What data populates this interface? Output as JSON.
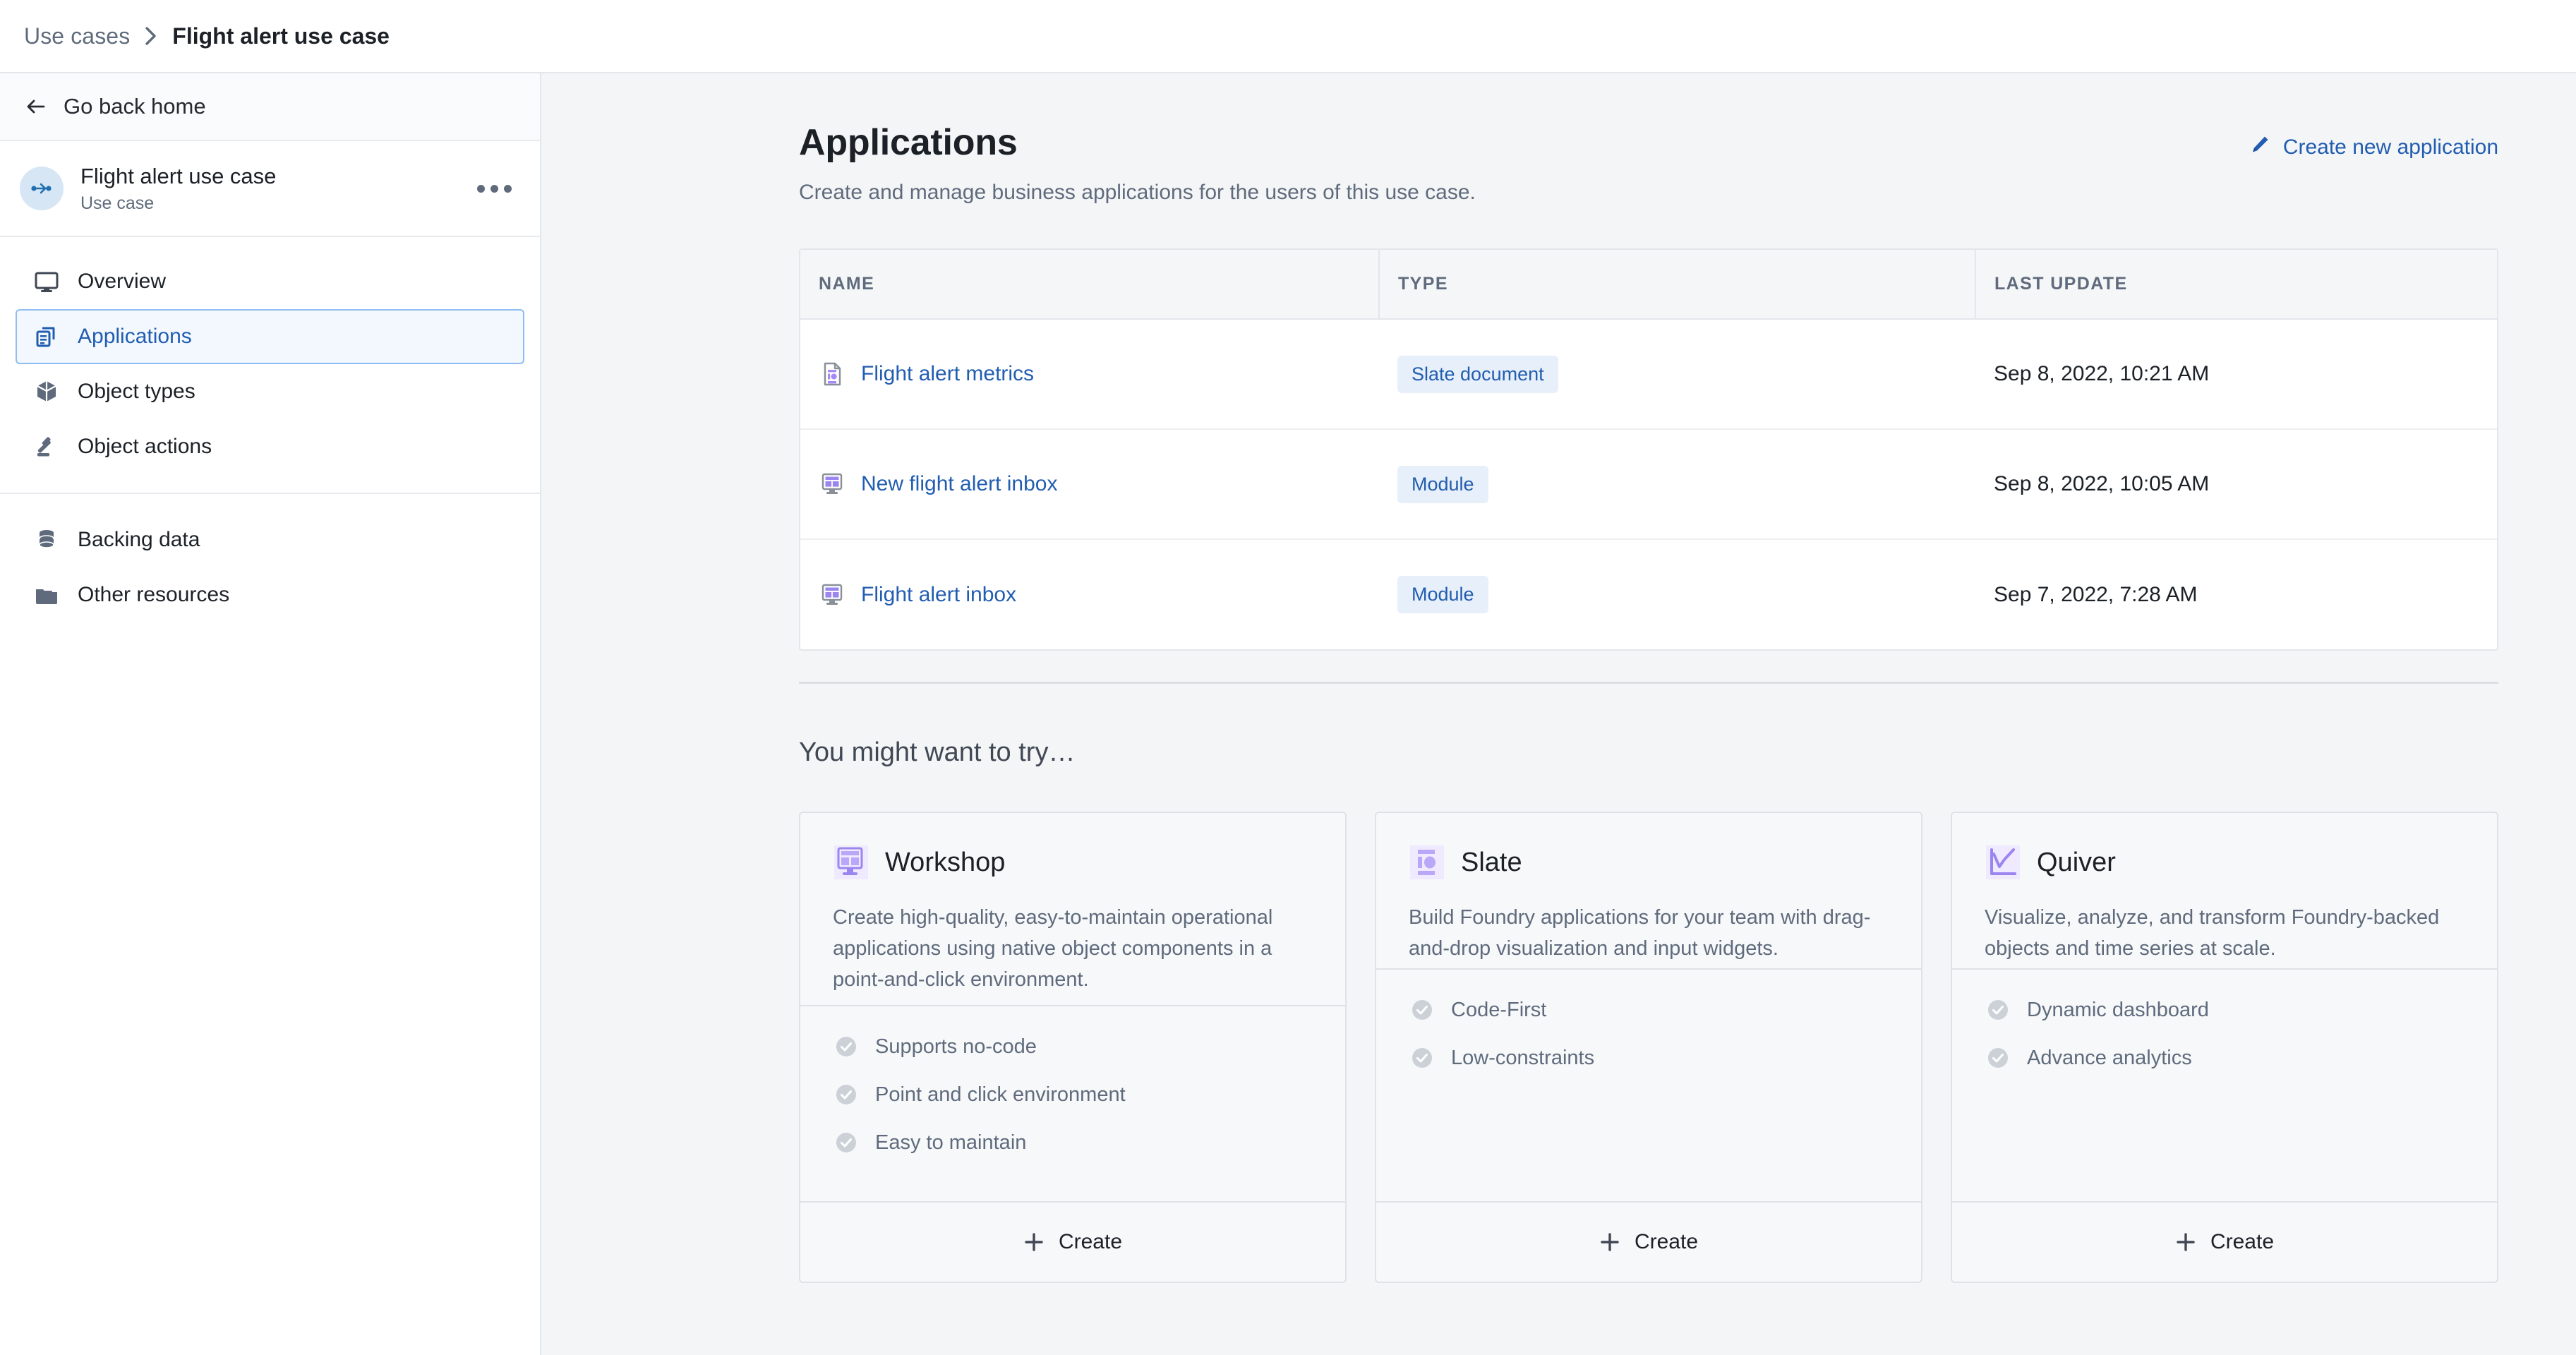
{
  "breadcrumb": {
    "parent": "Use cases",
    "separator": "›",
    "current": "Flight alert use case"
  },
  "sidebar": {
    "go_back_label": "Go back home",
    "go_back_icon": "arrow-left-icon",
    "usecase": {
      "icon": "flow-link-icon",
      "title": "Flight alert use case",
      "subtitle": "Use case",
      "more_icon": "more-horizontal-icon"
    },
    "nav_primary": [
      {
        "label": "Overview",
        "icon": "monitor-icon",
        "active": false
      },
      {
        "label": "Applications",
        "icon": "applications-icon",
        "active": true
      },
      {
        "label": "Object types",
        "icon": "cube-icon",
        "active": false
      },
      {
        "label": "Object actions",
        "icon": "gavel-icon",
        "active": false
      }
    ],
    "nav_secondary": [
      {
        "label": "Backing data",
        "icon": "database-icon",
        "active": false
      },
      {
        "label": "Other resources",
        "icon": "folder-icon",
        "active": false
      }
    ]
  },
  "main": {
    "title": "Applications",
    "subtitle": "Create and manage business applications for the users of this use case.",
    "create_new": {
      "label": "Create new application",
      "icon": "pencil-icon"
    },
    "table": {
      "columns": [
        "NAME",
        "TYPE",
        "LAST UPDATE"
      ],
      "rows": [
        {
          "name": "Flight alert metrics",
          "icon": "slate-document-icon",
          "type": "Slate document",
          "last_update": "Sep 8, 2022, 10:21 AM"
        },
        {
          "name": "New flight alert inbox",
          "icon": "module-icon",
          "type": "Module",
          "last_update": "Sep 8, 2022, 10:05 AM"
        },
        {
          "name": "Flight alert inbox",
          "icon": "module-icon",
          "type": "Module",
          "last_update": "Sep 7, 2022, 7:28 AM"
        }
      ]
    },
    "try_section": {
      "title": "You might want to try…",
      "cards": [
        {
          "title": "Workshop",
          "icon": "workshop-icon",
          "description": "Create high-quality, easy-to-maintain operational applications using native object components in a point-and-click environment.",
          "features": [
            "Supports no-code",
            "Point and click environment",
            "Easy to maintain"
          ],
          "create_label": "Create",
          "create_icon": "plus-icon"
        },
        {
          "title": "Slate",
          "icon": "slate-icon",
          "description": "Build Foundry applications for your team with drag-and-drop visualization and input widgets.",
          "features": [
            "Code-First",
            "Low-constraints"
          ],
          "create_label": "Create",
          "create_icon": "plus-icon"
        },
        {
          "title": "Quiver",
          "icon": "quiver-chart-icon",
          "description": "Visualize, analyze, and transform Foundry-backed objects and time series at scale.",
          "features": [
            "Dynamic dashboard",
            "Advance analytics"
          ],
          "create_label": "Create",
          "create_icon": "plus-icon"
        }
      ]
    }
  },
  "colors": {
    "link_blue": "#215db0",
    "accent_purple": "#8c7ae6",
    "muted_gray": "#5f6b7c",
    "page_bg": "#f4f5f7",
    "selected_bg": "#f3f8ff",
    "selected_border": "#8fbcf2"
  }
}
